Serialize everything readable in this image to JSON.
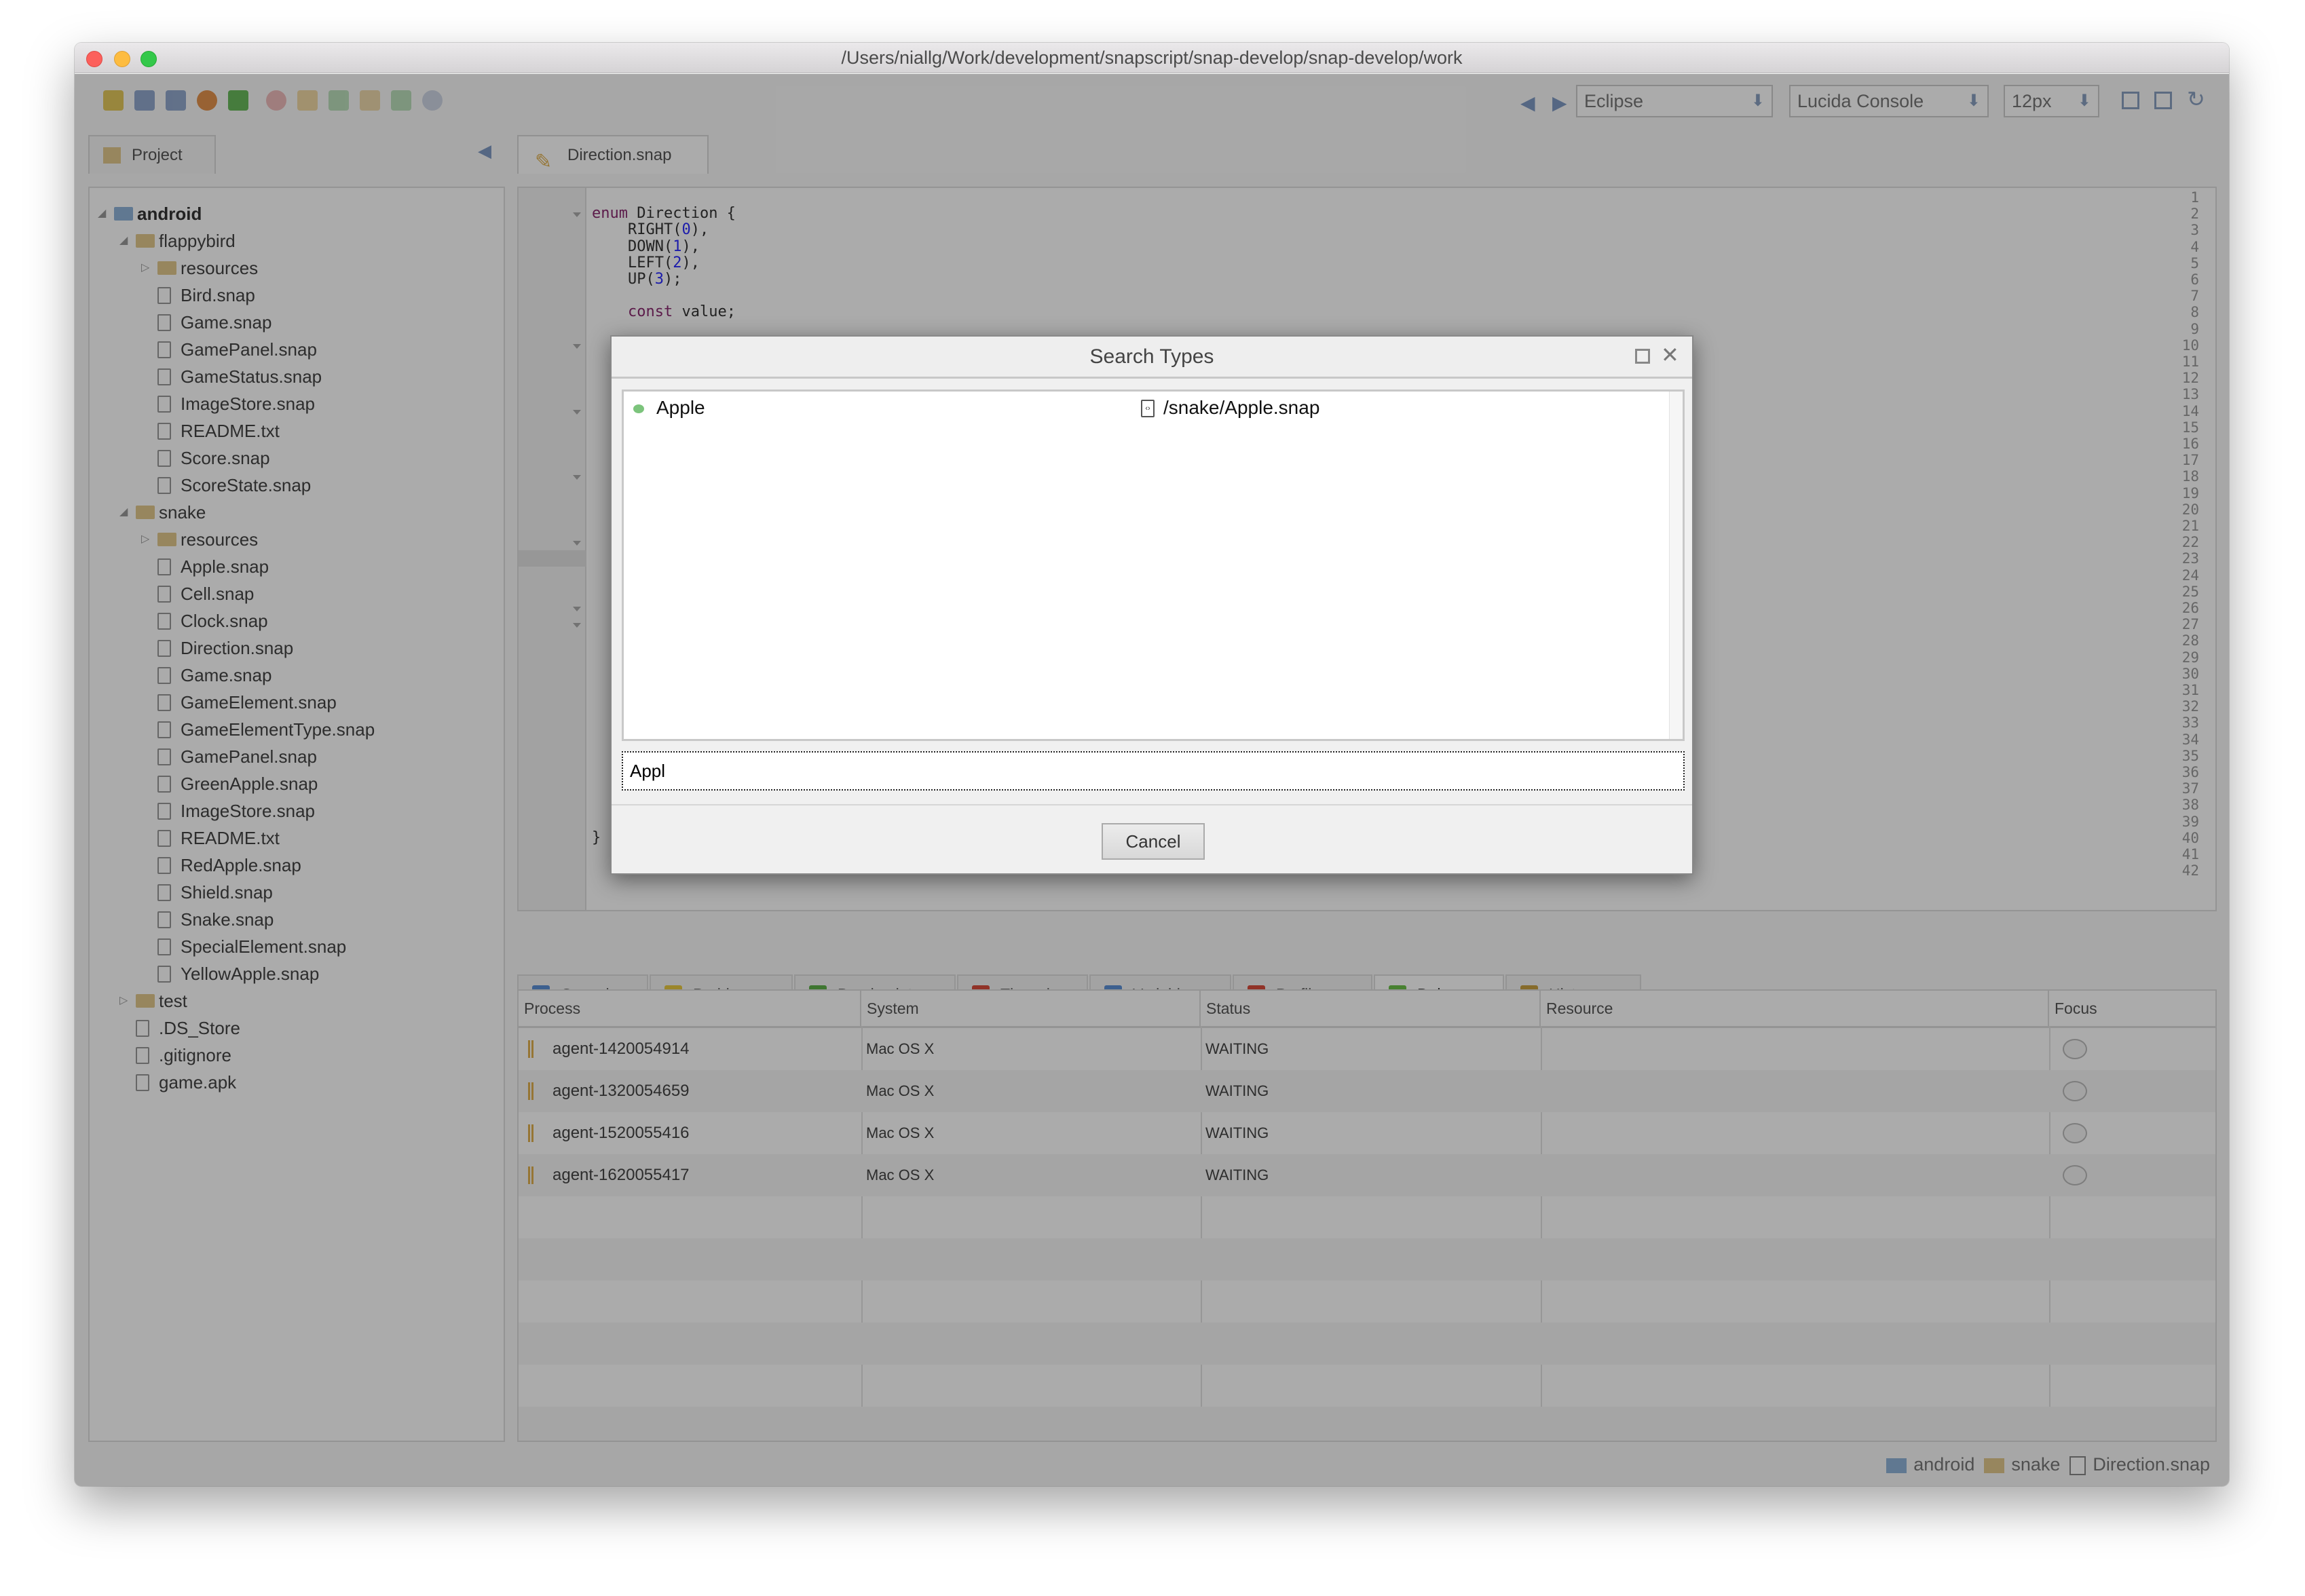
{
  "window": {
    "title": "/Users/niallg/Work/development/snapscript/snap-develop/snap-develop/work"
  },
  "toolbar": {
    "icons": [
      "star-icon",
      "save-icon",
      "trash-icon",
      "search-icon",
      "run-icon",
      "stop-icon",
      "resume-icon",
      "step-over-icon",
      "step-in-icon",
      "step-out-icon",
      "help-icon"
    ],
    "theme": "Eclipse",
    "font": "Lucida Console",
    "font_size": "12px"
  },
  "tabs": {
    "project": "Project",
    "editor": "Direction.snap"
  },
  "tree": [
    {
      "label": "android",
      "level": 0,
      "type": "folder",
      "exp": "open",
      "bold": true
    },
    {
      "label": "flappybird",
      "level": 1,
      "type": "folder",
      "exp": "open"
    },
    {
      "label": "resources",
      "level": 2,
      "type": "folder",
      "exp": "closed"
    },
    {
      "label": "Bird.snap",
      "level": 2,
      "type": "file"
    },
    {
      "label": "Game.snap",
      "level": 2,
      "type": "file"
    },
    {
      "label": "GamePanel.snap",
      "level": 2,
      "type": "file"
    },
    {
      "label": "GameStatus.snap",
      "level": 2,
      "type": "file"
    },
    {
      "label": "ImageStore.snap",
      "level": 2,
      "type": "file"
    },
    {
      "label": "README.txt",
      "level": 2,
      "type": "file"
    },
    {
      "label": "Score.snap",
      "level": 2,
      "type": "file"
    },
    {
      "label": "ScoreState.snap",
      "level": 2,
      "type": "file"
    },
    {
      "label": "snake",
      "level": 1,
      "type": "folder",
      "exp": "open"
    },
    {
      "label": "resources",
      "level": 2,
      "type": "folder",
      "exp": "closed"
    },
    {
      "label": "Apple.snap",
      "level": 2,
      "type": "file"
    },
    {
      "label": "Cell.snap",
      "level": 2,
      "type": "file"
    },
    {
      "label": "Clock.snap",
      "level": 2,
      "type": "file"
    },
    {
      "label": "Direction.snap",
      "level": 2,
      "type": "file"
    },
    {
      "label": "Game.snap",
      "level": 2,
      "type": "file"
    },
    {
      "label": "GameElement.snap",
      "level": 2,
      "type": "file"
    },
    {
      "label": "GameElementType.snap",
      "level": 2,
      "type": "file"
    },
    {
      "label": "GamePanel.snap",
      "level": 2,
      "type": "file"
    },
    {
      "label": "GreenApple.snap",
      "level": 2,
      "type": "file"
    },
    {
      "label": "ImageStore.snap",
      "level": 2,
      "type": "file"
    },
    {
      "label": "README.txt",
      "level": 2,
      "type": "file"
    },
    {
      "label": "RedApple.snap",
      "level": 2,
      "type": "file"
    },
    {
      "label": "Shield.snap",
      "level": 2,
      "type": "file"
    },
    {
      "label": "Snake.snap",
      "level": 2,
      "type": "file"
    },
    {
      "label": "SpecialElement.snap",
      "level": 2,
      "type": "file"
    },
    {
      "label": "YellowApple.snap",
      "level": 2,
      "type": "file"
    },
    {
      "label": "test",
      "level": 1,
      "type": "folder",
      "exp": "closed"
    },
    {
      "label": ".DS_Store",
      "level": 1,
      "type": "file"
    },
    {
      "label": ".gitignore",
      "level": 1,
      "type": "file"
    },
    {
      "label": "game.apk",
      "level": 1,
      "type": "file"
    }
  ],
  "editor": {
    "line_count": 42,
    "fold_lines": [
      2,
      10,
      14,
      18,
      22,
      26,
      27
    ],
    "current_line": 23,
    "code": [
      {
        "line": 2,
        "parts": [
          [
            "kw",
            "enum"
          ],
          [
            "t",
            " Direction {"
          ]
        ]
      },
      {
        "line": 3,
        "parts": [
          [
            "t",
            "    RIGHT("
          ],
          [
            "num",
            "0"
          ],
          [
            "t",
            "),"
          ]
        ]
      },
      {
        "line": 4,
        "parts": [
          [
            "t",
            "    DOWN("
          ],
          [
            "num",
            "1"
          ],
          [
            "t",
            "),"
          ]
        ]
      },
      {
        "line": 5,
        "parts": [
          [
            "t",
            "    LEFT("
          ],
          [
            "num",
            "2"
          ],
          [
            "t",
            "),"
          ]
        ]
      },
      {
        "line": 6,
        "parts": [
          [
            "t",
            "    UP("
          ],
          [
            "num",
            "3"
          ],
          [
            "t",
            ");"
          ]
        ]
      },
      {
        "line": 8,
        "parts": [
          [
            "t",
            "    "
          ],
          [
            "kw",
            "const"
          ],
          [
            "t",
            " value;"
          ]
        ]
      },
      {
        "line": 40,
        "parts": [
          [
            "t",
            "}"
          ]
        ]
      }
    ]
  },
  "bottom_tabs": [
    {
      "label": "Console",
      "color": "#5b8fd6"
    },
    {
      "label": "Problems",
      "color": "#e8c840"
    },
    {
      "label": "Breakpoints",
      "color": "#5fb04a"
    },
    {
      "label": "Threads",
      "color": "#d84c3c"
    },
    {
      "label": "Variables",
      "color": "#5b8fd6"
    },
    {
      "label": "Profiler",
      "color": "#d84c3c"
    },
    {
      "label": "Debug",
      "color": "#6cc04a",
      "active": true
    },
    {
      "label": "History",
      "color": "#c8a040"
    }
  ],
  "table": {
    "headers": [
      "Process",
      "System",
      "Status",
      "Resource",
      "Focus"
    ],
    "rows": [
      {
        "process": "agent-1420054914",
        "system": "Mac OS X",
        "status": "WAITING",
        "resource": ""
      },
      {
        "process": "agent-1320054659",
        "system": "Mac OS X",
        "status": "WAITING",
        "resource": ""
      },
      {
        "process": "agent-1520055416",
        "system": "Mac OS X",
        "status": "WAITING",
        "resource": ""
      },
      {
        "process": "agent-1620055417",
        "system": "Mac OS X",
        "status": "WAITING",
        "resource": ""
      }
    ]
  },
  "breadcrumb": [
    "android",
    "snake",
    "Direction.snap"
  ],
  "dialog": {
    "title": "Search Types",
    "results": [
      {
        "name": "Apple",
        "path": "/snake/Apple.snap",
        "status_color": "#7cc47c"
      }
    ],
    "query": "Appl",
    "cancel": "Cancel"
  }
}
